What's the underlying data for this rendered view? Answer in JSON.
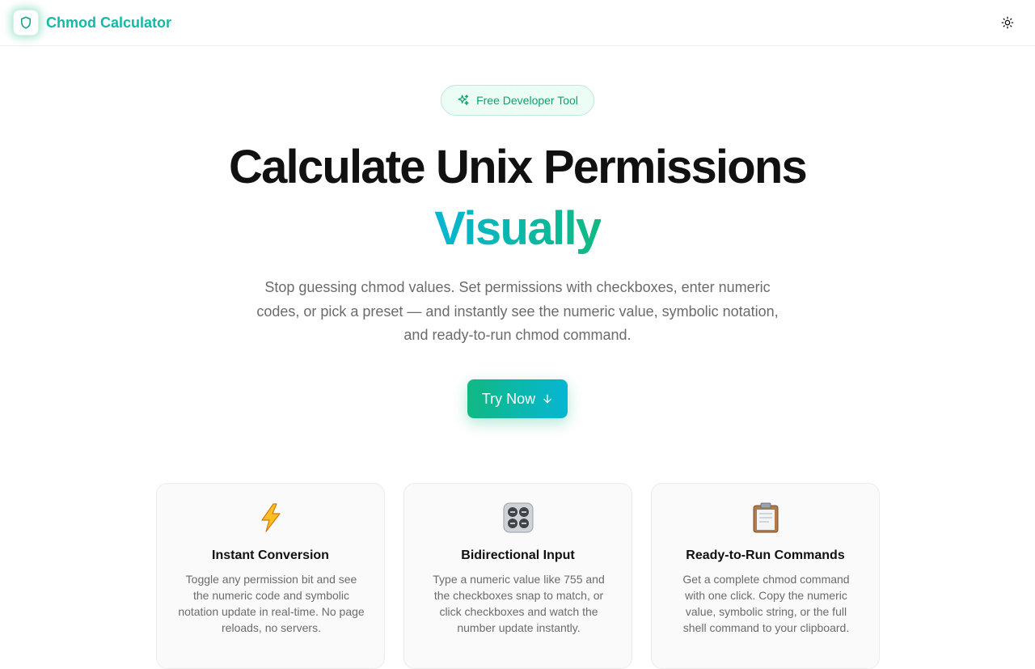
{
  "header": {
    "brand": "Chmod Calculator",
    "logo_icon": "shield-icon",
    "theme_icon": "sun-icon"
  },
  "hero": {
    "badge": "Free Developer Tool",
    "badge_icon": "sparkles-icon",
    "title_line1": "Calculate Unix Permissions",
    "title_line2": "Visually",
    "subtitle": "Stop guessing chmod values. Set permissions with checkboxes, enter numeric codes, or pick a preset — and instantly see the numeric value, symbolic notation, and ready-to-run chmod command.",
    "cta_label": "Try Now",
    "cta_icon": "arrow-down-icon"
  },
  "features": [
    {
      "icon": "lightning-icon",
      "title": "Instant Conversion",
      "text": "Toggle any permission bit and see the numeric code and symbolic notation update in real-time. No page reloads, no servers."
    },
    {
      "icon": "control-knobs-icon",
      "title": "Bidirectional Input",
      "text": "Type a numeric value like 755 and the checkboxes snap to match, or click checkboxes and watch the number update instantly."
    },
    {
      "icon": "clipboard-icon",
      "title": "Ready-to-Run Commands",
      "text": "Get a complete chmod command with one click. Copy the numeric value, symbolic string, or the full shell command to your clipboard."
    }
  ],
  "colors": {
    "accent_green": "#10b981",
    "accent_cyan": "#06b6d4",
    "brand_teal": "#14b8a6"
  }
}
